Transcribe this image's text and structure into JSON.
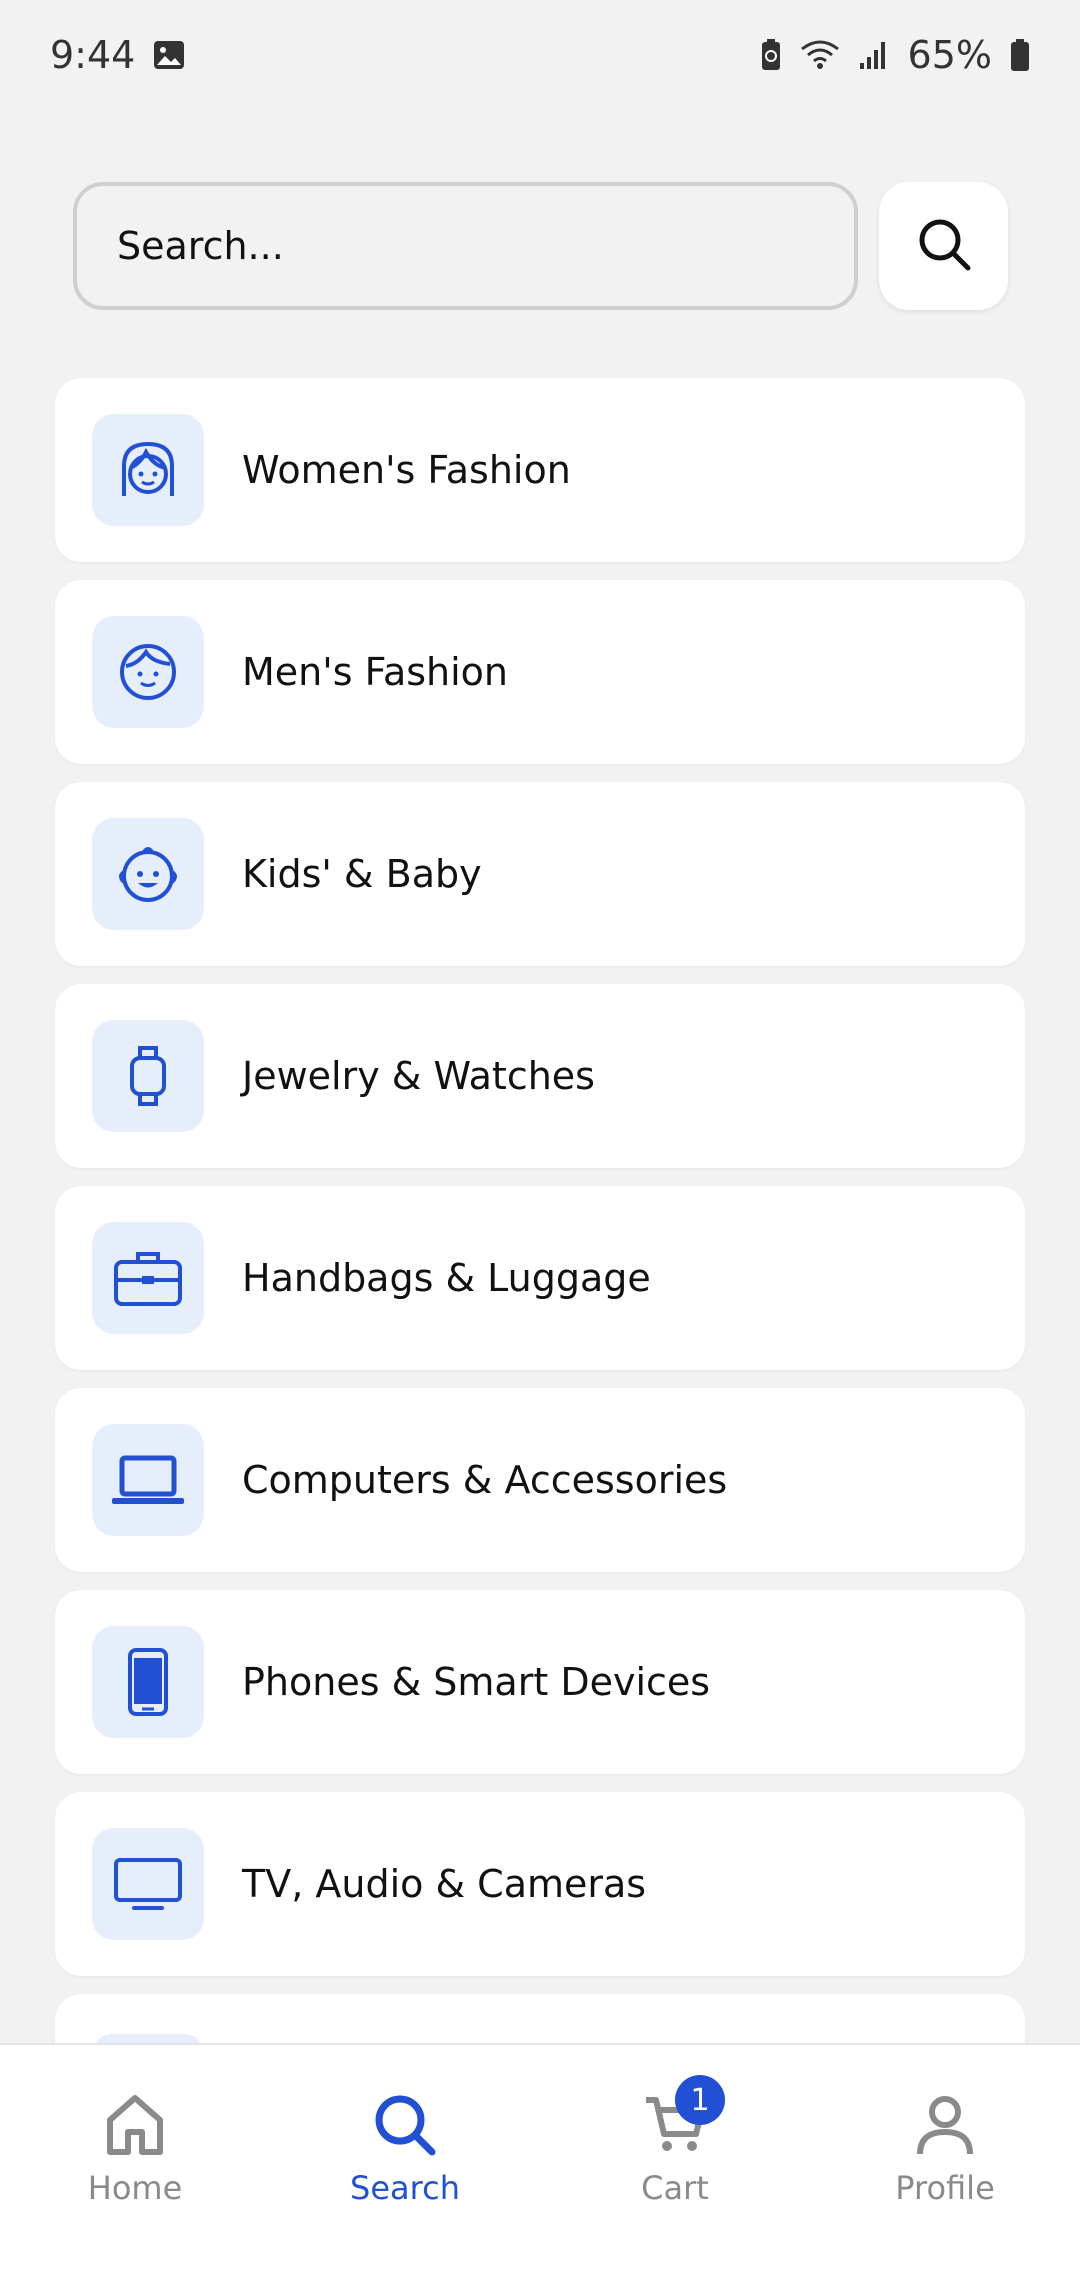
{
  "status_bar": {
    "time": "9:44",
    "battery": "65%"
  },
  "search": {
    "placeholder": "Search..."
  },
  "categories": [
    {
      "label": "Women's Fashion",
      "icon": "woman-icon"
    },
    {
      "label": "Men's Fashion",
      "icon": "man-icon"
    },
    {
      "label": "Kids' & Baby",
      "icon": "baby-icon"
    },
    {
      "label": "Jewelry & Watches",
      "icon": "watch-icon"
    },
    {
      "label": "Handbags & Luggage",
      "icon": "briefcase-icon"
    },
    {
      "label": "Computers & Accessories",
      "icon": "laptop-icon"
    },
    {
      "label": "Phones & Smart Devices",
      "icon": "smartphone-icon"
    },
    {
      "label": "TV, Audio & Cameras",
      "icon": "tv-icon"
    }
  ],
  "bottom_nav": {
    "home": "Home",
    "search": "Search",
    "cart": "Cart",
    "cart_badge": "1",
    "profile": "Profile"
  },
  "colors": {
    "accent": "#2250d4",
    "icon_bg": "#e6eefc",
    "page_bg": "#f2f2f2"
  }
}
